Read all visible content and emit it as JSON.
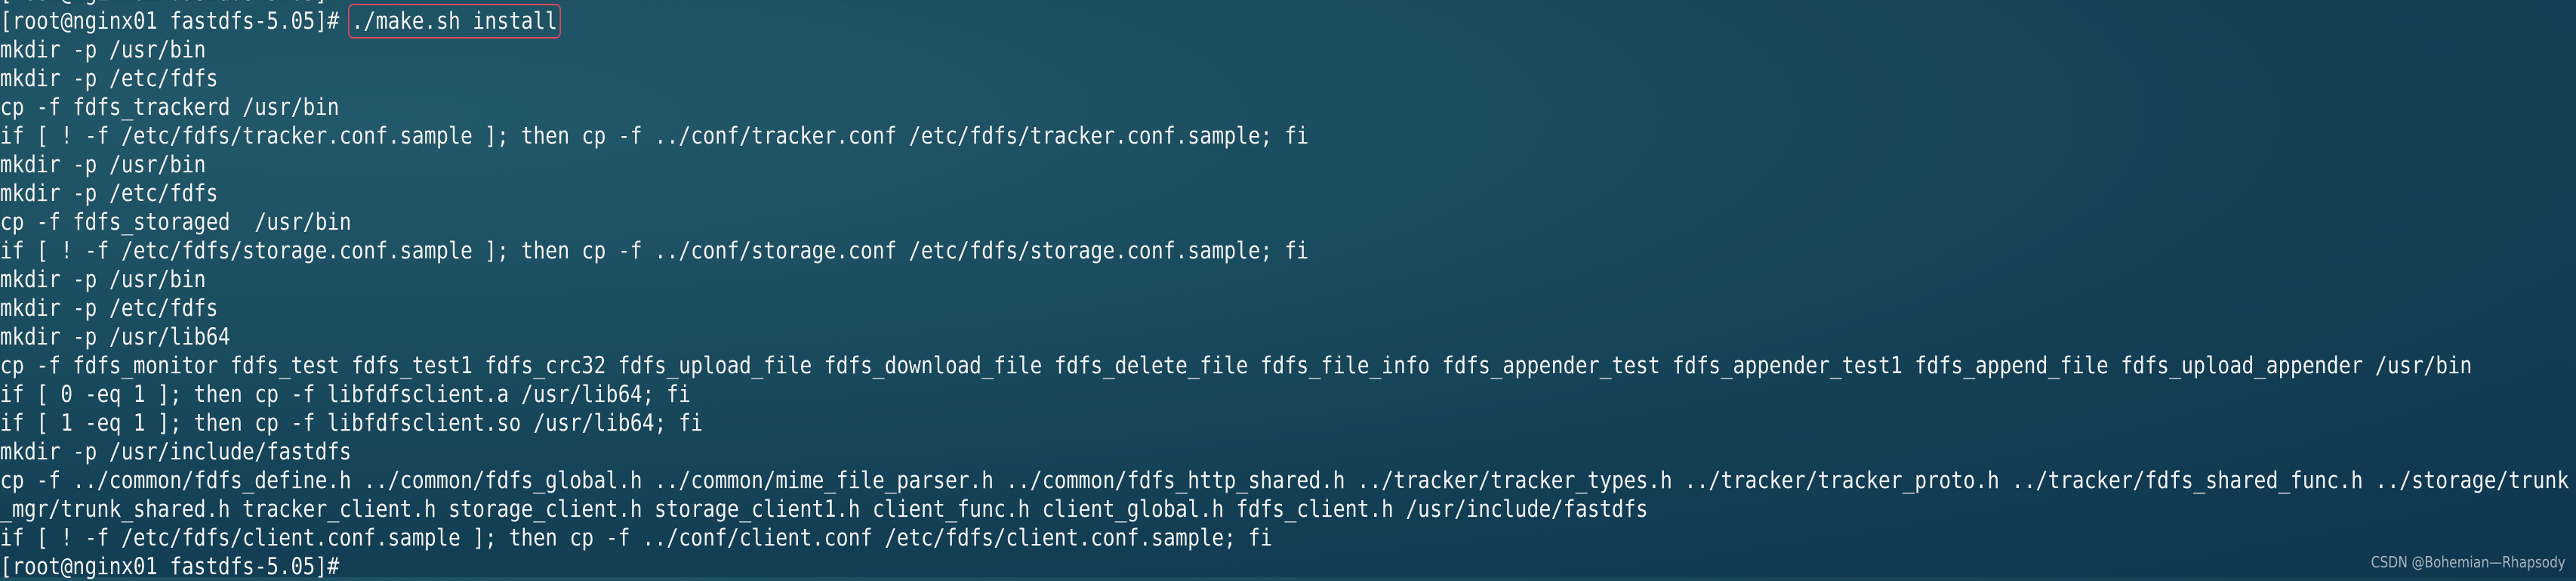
{
  "terminal": {
    "prompt_prev": "[root@nginx01 fastdfs-5.05]#",
    "prompt": "[root@nginx01 fastdfs-5.05]# ",
    "command": "./make.sh install",
    "output": [
      "mkdir -p /usr/bin",
      "mkdir -p /etc/fdfs",
      "cp -f fdfs_trackerd /usr/bin",
      "if [ ! -f /etc/fdfs/tracker.conf.sample ]; then cp -f ../conf/tracker.conf /etc/fdfs/tracker.conf.sample; fi",
      "mkdir -p /usr/bin",
      "mkdir -p /etc/fdfs",
      "cp -f fdfs_storaged  /usr/bin",
      "if [ ! -f /etc/fdfs/storage.conf.sample ]; then cp -f ../conf/storage.conf /etc/fdfs/storage.conf.sample; fi",
      "mkdir -p /usr/bin",
      "mkdir -p /etc/fdfs",
      "mkdir -p /usr/lib64",
      "cp -f fdfs_monitor fdfs_test fdfs_test1 fdfs_crc32 fdfs_upload_file fdfs_download_file fdfs_delete_file fdfs_file_info fdfs_appender_test fdfs_appender_test1 fdfs_append_file fdfs_upload_appender /usr/bin",
      "if [ 0 -eq 1 ]; then cp -f libfdfsclient.a /usr/lib64; fi",
      "if [ 1 -eq 1 ]; then cp -f libfdfsclient.so /usr/lib64; fi",
      "mkdir -p /usr/include/fastdfs",
      "cp -f ../common/fdfs_define.h ../common/fdfs_global.h ../common/mime_file_parser.h ../common/fdfs_http_shared.h ../tracker/tracker_types.h ../tracker/tracker_proto.h ../tracker/fdfs_shared_func.h ../storage/trunk",
      "_mgr/trunk_shared.h tracker_client.h storage_client.h storage_client1.h client_func.h client_global.h fdfs_client.h /usr/include/fastdfs",
      "if [ ! -f /etc/fdfs/client.conf.sample ]; then cp -f ../conf/client.conf /etc/fdfs/client.conf.sample; fi"
    ],
    "final_prompt": "[root@nginx01 fastdfs-5.05]#"
  },
  "watermark": "CSDN @Bohemian—Rhapsody",
  "colors": {
    "text": "#f2f4f4",
    "highlight_box": "#e0455d",
    "background": "#173f55"
  }
}
